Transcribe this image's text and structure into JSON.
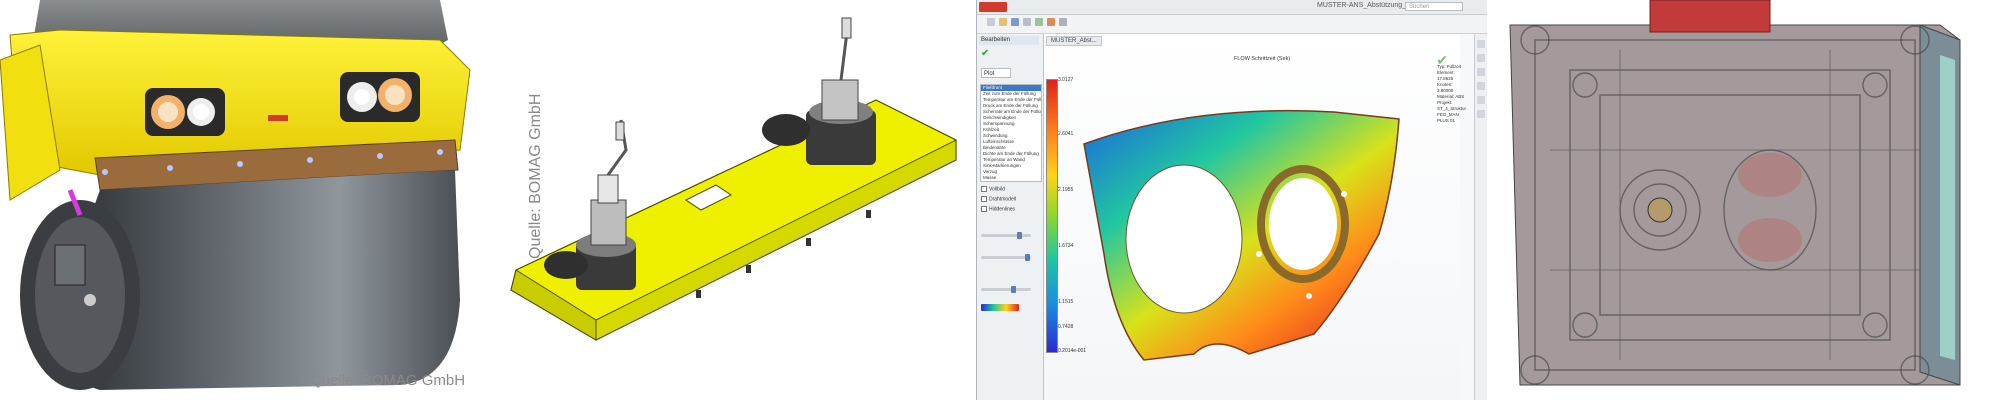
{
  "panels": {
    "roller": {
      "caption": "Quelle: BOMAG GmbH"
    },
    "bracket": {
      "caption": "Quelle: BOMAG GmbH"
    },
    "solidworks": {
      "document_title": "MUSTER-ANS_Abstützung_FT1.SLDPRT",
      "search_placeholder": "Suchen",
      "doc_tab": "MUSTER_Abst...",
      "property_manager_title": "Bearbeiten",
      "tab_label": "Plot",
      "list_items": [
        "Fließfront",
        "Zeit zum Ende der Füllung",
        "Temperatur am Ende der Füllung",
        "Druck am Ende der Füllung",
        "Scherrate am Ende der Füllung",
        "Geschwindigkeit",
        "Scherspannung",
        "Kühlzeit",
        "Schwindung",
        "Lufteinschlüsse",
        "Bindenähte",
        "Dichte am Ende der Füllung",
        "Temperatur an Wand",
        "Sink-Markierungen",
        "Verzug",
        "Masse"
      ],
      "options": [
        "Vollbild",
        "Drahtmodell",
        "Hiddenlines"
      ],
      "plot_title": "FLOW Schrittzeit (Sek)",
      "info_lines": [
        "Typ: Füllzeit",
        "Element: 17.8625",
        "Knoten: 3.80000",
        "Material: ABS",
        "Projekt: ST_4_Struktur FEG_MAN PLUS 01"
      ],
      "legend_values": [
        "3.0127",
        "2.6041",
        "2.1955",
        "1.6734",
        "1.1515",
        "0.7428",
        "0.2014e-001"
      ],
      "colors": {
        "legend_top": "#e0221d",
        "legend_bottom": "#2a2ad2",
        "ui_bar": "#d23a2c"
      }
    }
  }
}
